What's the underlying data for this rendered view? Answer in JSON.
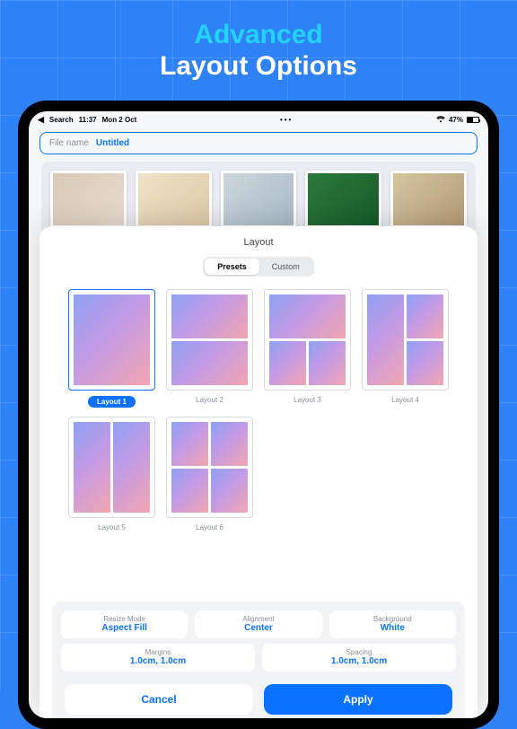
{
  "headline": {
    "line1": "Advanced",
    "line2": "Layout Options"
  },
  "status": {
    "back": "Search",
    "time": "11:37",
    "date": "Mon 2 Oct",
    "battery_pct": "47%"
  },
  "filename": {
    "label": "File name",
    "value": "Untitled"
  },
  "sheet": {
    "title": "Layout",
    "segments": {
      "presets": "Presets",
      "custom": "Custom"
    },
    "layouts": {
      "l1": "Layout 1",
      "l2": "Layout 2",
      "l3": "Layout 3",
      "l4": "Layout 4",
      "l5": "Layout 5",
      "l6": "Layout 6"
    },
    "options": {
      "resize": {
        "k": "Resize Mode",
        "v": "Aspect Fill"
      },
      "alignment": {
        "k": "Alignment",
        "v": "Center"
      },
      "background": {
        "k": "Background",
        "v": "White"
      },
      "margins": {
        "k": "Margins",
        "v": "1.0cm, 1.0cm"
      },
      "spacing": {
        "k": "Spacing",
        "v": "1.0cm, 1.0cm"
      }
    },
    "actions": {
      "cancel": "Cancel",
      "apply": "Apply"
    }
  }
}
